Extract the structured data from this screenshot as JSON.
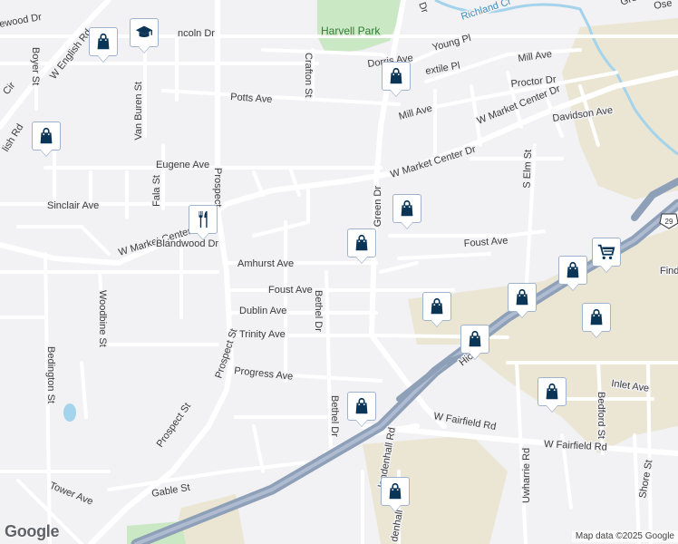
{
  "map": {
    "attribution": "Map data ©2025 Google",
    "logo": "Google",
    "park": "Harvell Park",
    "water": "Richland Cr",
    "highway_shield": "29",
    "streets": {
      "w_english_rd": "W English Rd",
      "boyer": "Boyer St",
      "mewood": "ewood Dr",
      "lish_rd": "lish Rd",
      "cir": "Cir",
      "van_buren": "Van Buren St",
      "lincoln": "ncoln Dr",
      "crafton": "Crafton St",
      "dorris": "Dorris Ave",
      "young": "Young Pl",
      "textile": "extile Pl",
      "mill_ave_ne": "Mill Ave",
      "proctor": "Proctor Dr",
      "potts": "Potts Ave",
      "mill_ave": "Mill Ave",
      "w_market_center_ne": "W Market Center Dr",
      "davidson": "Davidson Ave",
      "eugene": "Eugene Ave",
      "fala": "Fala St",
      "prospect_n": "Prospect",
      "w_market_center_mid": "W Market Center Dr",
      "w_market_center_w": "W Market Center Dr",
      "s_elm": "S Elm St",
      "sinclair": "Sinclair Ave",
      "green": "Green Dr",
      "blandwood": "Blandwood Dr",
      "foust_e": "Foust Ave",
      "amhurst": "Amhurst Ave",
      "foust": "Foust Ave",
      "bethel_n": "Bethel Dr",
      "dublin": "Dublin Ave",
      "trinity": "Trinity Ave",
      "woodbine": "Woodbine St",
      "prospect_s": "Prospect St",
      "progress": "Progress Ave",
      "bedington": "Bedington St",
      "bethel_s": "Bethel Dr",
      "hickory": "Hick",
      "inlet": "Inlet Ave",
      "bedford": "Bedford St",
      "w_fairfield_w": "W Fairfield Rd",
      "w_fairfield_e": "W Fairfield Rd",
      "findlay": "Find",
      "prospect_sw": "Prospect St",
      "lindenhall": "lendenhall Rd",
      "lindenhall_s": "denhall",
      "uwharrie": "Uwharrie Rd",
      "shore": "Shore St",
      "tower": "Tower Ave",
      "gable": "Gable St",
      "ose": "Ose",
      "gre": "Gre",
      "dr": "Dr"
    }
  },
  "markers": [
    {
      "name": "shopping-bag-marker",
      "icon": "shopping-bag-icon"
    },
    {
      "name": "school-marker",
      "icon": "graduation-cap-icon"
    },
    {
      "name": "shopping-bag-marker",
      "icon": "shopping-bag-icon"
    },
    {
      "name": "shopping-bag-marker",
      "icon": "shopping-bag-icon"
    },
    {
      "name": "restaurant-marker",
      "icon": "fork-knife-icon"
    },
    {
      "name": "shopping-bag-marker",
      "icon": "shopping-bag-icon"
    },
    {
      "name": "shopping-bag-marker",
      "icon": "shopping-bag-icon"
    },
    {
      "name": "grocery-cart-marker",
      "icon": "shopping-cart-icon"
    },
    {
      "name": "shopping-bag-marker",
      "icon": "shopping-bag-icon"
    },
    {
      "name": "shopping-bag-marker",
      "icon": "shopping-bag-icon"
    },
    {
      "name": "shopping-bag-marker",
      "icon": "shopping-bag-icon"
    },
    {
      "name": "shopping-bag-marker",
      "icon": "shopping-bag-icon"
    },
    {
      "name": "shopping-bag-marker",
      "icon": "shopping-bag-icon"
    },
    {
      "name": "shopping-bag-marker",
      "icon": "shopping-bag-icon"
    },
    {
      "name": "shopping-bag-marker",
      "icon": "shopping-bag-icon"
    },
    {
      "name": "shopping-bag-marker",
      "icon": "shopping-bag-icon"
    }
  ],
  "colors": {
    "background": "#f2f1f4",
    "road": "#ffffff",
    "highway": "#8e9fb8",
    "park": "#c9e8c3",
    "water": "#a4d3ec",
    "urban": "#ebe6d3",
    "marker_icon": "#0b3556"
  }
}
